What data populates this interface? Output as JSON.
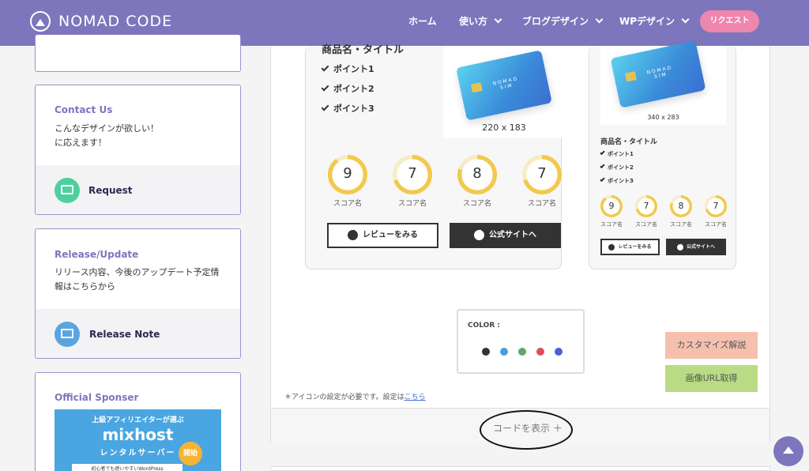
{
  "header": {
    "logo": "NOMAD CODE",
    "nav": [
      "ホーム",
      "使い方",
      "ブログデザイン",
      "WPデザイン"
    ],
    "request_button": "リクエスト",
    "bg_color": "#7d76bd",
    "accent_pink": "#ee86ad"
  },
  "sidebar": {
    "contact": {
      "title": "Contact Us",
      "text_line1": "こんなデザインが欲しい！",
      "text_line2": "に応えます！",
      "link_label": "Request",
      "icon": "mail-icon",
      "icon_color": "#4fcf9f"
    },
    "release": {
      "title": "Release/Update",
      "text": "リリース内容、今後のアップデート予定情報はこちらから",
      "link_label": "Release Note",
      "icon": "edit-icon",
      "icon_color": "#5aa5e0"
    },
    "sponsor": {
      "title": "Official Sponser",
      "banner_top": "上級アフィリエイターが選ぶ",
      "banner_brand": "mixhost",
      "banner_sub": "レンタルサーバー",
      "banner_badge": "開始",
      "banner_strip": "初心者でも使いやすいWordPress"
    }
  },
  "main": {
    "card_large": {
      "title": "商品名・タイトル",
      "points": [
        "ポイント1",
        "ポイント2",
        "ポイント3"
      ],
      "image_caption": "220 x 183",
      "sim_text": "NOMAD SIM",
      "scores": [
        {
          "value": "9",
          "label": "スコア名",
          "fraction": 0.9
        },
        {
          "value": "7",
          "label": "スコア名",
          "fraction": 0.7
        },
        {
          "value": "8",
          "label": "スコア名",
          "fraction": 0.8
        },
        {
          "value": "7",
          "label": "スコア名",
          "fraction": 0.7
        }
      ],
      "review_button": "レビューをみる",
      "official_button": "公式サイトへ"
    },
    "card_small": {
      "title": "商品名・タイトル",
      "points": [
        "ポイント1",
        "ポイント2",
        "ポイント3"
      ],
      "image_caption": "340 x 283",
      "sim_text": "NOMAD SIM",
      "scores": [
        {
          "value": "9",
          "label": "スコア名",
          "fraction": 0.9
        },
        {
          "value": "7",
          "label": "スコア名",
          "fraction": 0.7
        },
        {
          "value": "8",
          "label": "スコア名",
          "fraction": 0.8
        },
        {
          "value": "7",
          "label": "スコア名",
          "fraction": 0.7
        }
      ],
      "review_button": "レビューをみる",
      "official_button": "公式サイトへ"
    },
    "color_panel": {
      "label": "COLOR :",
      "colors": [
        "#333333",
        "#4a9fe0",
        "#5ca86b",
        "#d94f5e",
        "#4a5fd6"
      ]
    },
    "customize_button": "カスタマイズ解説",
    "image_url_button": "画像URL取得",
    "note_text": "＊アイコンの設定が必要です。設定は",
    "note_link": "こちら",
    "show_code": "コードを表示 ＋",
    "score_color": "#f2c94c"
  }
}
